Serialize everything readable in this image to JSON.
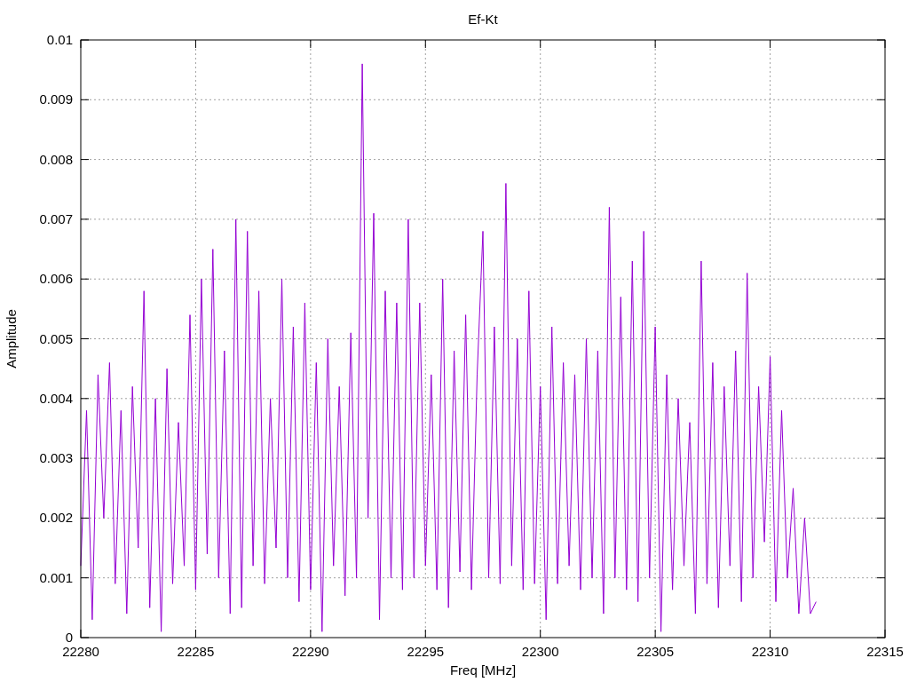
{
  "chart_data": {
    "type": "line",
    "title": "Ef-Kt",
    "grid": true,
    "xlabel": "Freq [MHz]",
    "ylabel": "Amplitude",
    "xlim": [
      22280,
      22315
    ],
    "ylim": [
      0,
      0.01
    ],
    "xticks": [
      22280,
      22285,
      22290,
      22295,
      22300,
      22305,
      22310,
      22315
    ],
    "yticks": [
      0,
      0.001,
      0.002,
      0.003,
      0.004,
      0.005,
      0.006,
      0.007,
      0.008,
      0.009,
      0.01
    ],
    "x": [
      22280,
      22280.25,
      22280.5,
      22280.75,
      22281,
      22281.25,
      22281.5,
      22281.75,
      22282,
      22282.25,
      22282.5,
      22282.75,
      22283,
      22283.25,
      22283.5,
      22283.75,
      22284,
      22284.25,
      22284.5,
      22284.75,
      22285,
      22285.25,
      22285.5,
      22285.75,
      22286,
      22286.25,
      22286.5,
      22286.75,
      22287,
      22287.25,
      22287.5,
      22287.75,
      22288,
      22288.25,
      22288.5,
      22288.75,
      22289,
      22289.25,
      22289.5,
      22289.75,
      22290,
      22290.25,
      22290.5,
      22290.75,
      22291,
      22291.25,
      22291.5,
      22291.75,
      22292,
      22292.25,
      22292.5,
      22292.75,
      22293,
      22293.25,
      22293.5,
      22293.75,
      22294,
      22294.25,
      22294.5,
      22294.75,
      22295,
      22295.25,
      22295.5,
      22295.75,
      22296,
      22296.25,
      22296.5,
      22296.75,
      22297,
      22297.25,
      22297.5,
      22297.75,
      22298,
      22298.25,
      22298.5,
      22298.75,
      22299,
      22299.25,
      22299.5,
      22299.75,
      22300,
      22300.25,
      22300.5,
      22300.75,
      22301,
      22301.25,
      22301.5,
      22301.75,
      22302,
      22302.25,
      22302.5,
      22302.75,
      22303,
      22303.25,
      22303.5,
      22303.75,
      22304,
      22304.25,
      22304.5,
      22304.75,
      22305,
      22305.25,
      22305.5,
      22305.75,
      22306,
      22306.25,
      22306.5,
      22306.75,
      22307,
      22307.25,
      22307.5,
      22307.75,
      22308,
      22308.25,
      22308.5,
      22308.75,
      22309,
      22309.25,
      22309.5,
      22309.75,
      22310,
      22310.25,
      22310.5,
      22310.75,
      22311,
      22311.25,
      22311.5,
      22311.75,
      22312
    ],
    "series": [
      {
        "color": "#9400d3",
        "values": [
          0.0012,
          0.0038,
          0.0003,
          0.0044,
          0.002,
          0.0046,
          0.0009,
          0.0038,
          0.0004,
          0.0042,
          0.0015,
          0.0058,
          0.0005,
          0.004,
          0.0001,
          0.0045,
          0.0009,
          0.0036,
          0.0012,
          0.0054,
          0.0008,
          0.006,
          0.0014,
          0.0065,
          0.001,
          0.0048,
          0.0004,
          0.007,
          0.0005,
          0.0068,
          0.0012,
          0.0058,
          0.0009,
          0.004,
          0.0015,
          0.006,
          0.001,
          0.0052,
          0.0006,
          0.0056,
          0.0008,
          0.0046,
          0.0001,
          0.005,
          0.0012,
          0.0042,
          0.0007,
          0.0051,
          0.001,
          0.0096,
          0.002,
          0.0071,
          0.0003,
          0.0058,
          0.001,
          0.0056,
          0.0008,
          0.007,
          0.001,
          0.0056,
          0.0012,
          0.0044,
          0.0008,
          0.006,
          0.0005,
          0.0048,
          0.0011,
          0.0054,
          0.0008,
          0.0044,
          0.0068,
          0.001,
          0.0052,
          0.0009,
          0.0076,
          0.0012,
          0.005,
          0.0008,
          0.0058,
          0.0009,
          0.0042,
          0.0003,
          0.0052,
          0.0009,
          0.0046,
          0.0012,
          0.0044,
          0.0008,
          0.005,
          0.001,
          0.0048,
          0.0004,
          0.0072,
          0.001,
          0.0057,
          0.0008,
          0.0063,
          0.0006,
          0.0068,
          0.001,
          0.0052,
          0.0001,
          0.0044,
          0.0008,
          0.004,
          0.0012,
          0.0036,
          0.0004,
          0.0063,
          0.0009,
          0.0046,
          0.0005,
          0.0042,
          0.0012,
          0.0048,
          0.0006,
          0.0061,
          0.001,
          0.0042,
          0.0016,
          0.0047,
          0.0006,
          0.0038,
          0.001,
          0.0025,
          0.0004,
          0.002,
          0.0004,
          0.0006
        ]
      }
    ]
  }
}
